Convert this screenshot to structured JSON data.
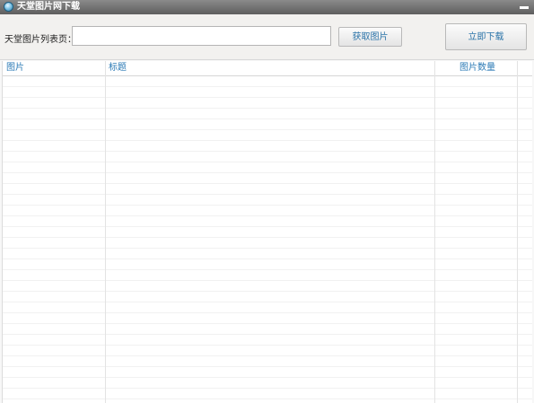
{
  "window": {
    "title": "天堂图片网下载",
    "icon": "app-globe-icon"
  },
  "toolbar": {
    "url_label": "天堂图片列表页：",
    "url_value": "",
    "fetch_button": "获取图片",
    "download_button": "立即下载"
  },
  "table": {
    "columns": [
      "图片",
      "标题",
      "图片数量"
    ]
  },
  "colors": {
    "titlebar": "#6f6f6f",
    "header_text": "#2a79b5",
    "button_text": "#2a73a8"
  }
}
